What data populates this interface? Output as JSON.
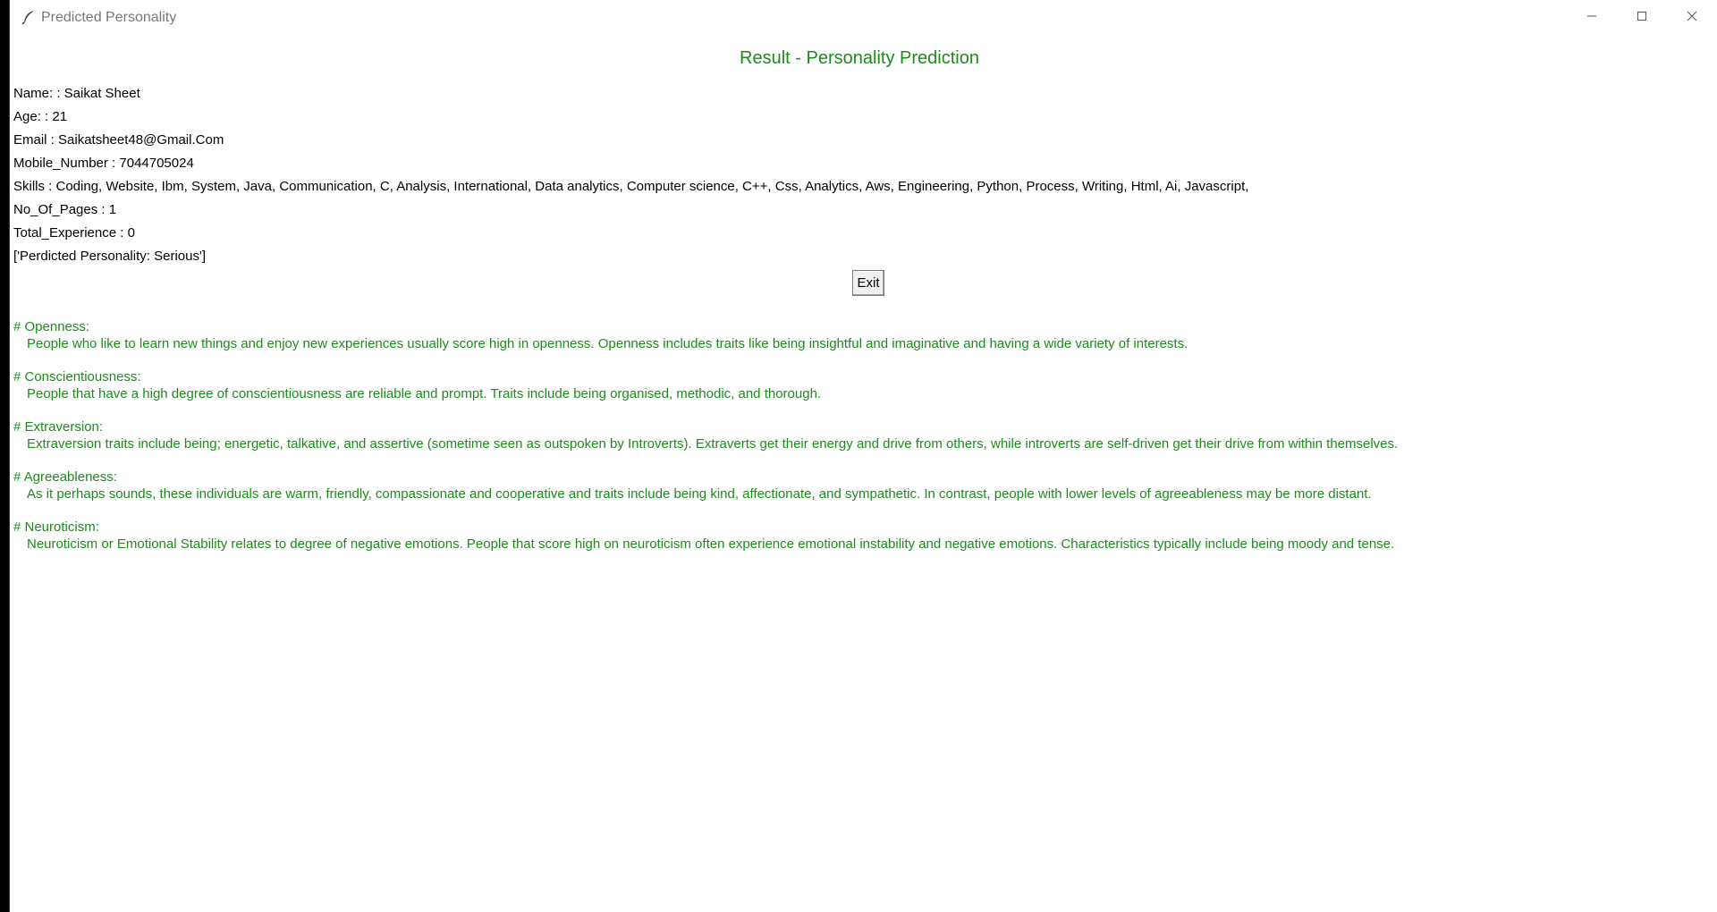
{
  "window": {
    "title": "Predicted Personality"
  },
  "heading": "Result - Personality Prediction",
  "info": {
    "name": "Name: : Saikat Sheet",
    "age": "Age: : 21",
    "email": "Email : Saikatsheet48@Gmail.Com",
    "mobile": "Mobile_Number : 7044705024",
    "skills": "Skills : Coding, Website, Ibm, System, Java, Communication, C, Analysis, International, Data analytics, Computer science, C++, Css, Analytics, Aws, Engineering, Python, Process, Writing, Html, Ai, Javascript,",
    "pages": "No_Of_Pages : 1",
    "experience": "Total_Experience : 0",
    "prediction": "['Perdicted Personality: Serious']"
  },
  "exit_label": "Exit",
  "traits": [
    {
      "title": "# Openness:",
      "description": "People who like to learn new things and enjoy new experiences usually score high in openness. Openness includes traits like being insightful and imaginative and having a wide variety of interests."
    },
    {
      "title": "# Conscientiousness:",
      "description": "People that have a high degree of conscientiousness are reliable and prompt. Traits include being organised, methodic, and thorough."
    },
    {
      "title": "# Extraversion:",
      "description": "Extraversion traits include being; energetic, talkative, and assertive (sometime seen as outspoken by Introverts). Extraverts get their energy and drive from others, while introverts are self-driven get their drive from within themselves."
    },
    {
      "title": "# Agreeableness:",
      "description": "As it perhaps sounds, these individuals are warm, friendly, compassionate and cooperative and traits include being kind, affectionate, and sympathetic. In contrast, people with lower levels of agreeableness may be more distant."
    },
    {
      "title": "# Neuroticism:",
      "description": "Neuroticism or Emotional Stability relates to degree of negative emotions. People that score high on neuroticism often experience emotional instability and negative emotions. Characteristics typically include being moody and tense."
    }
  ],
  "colors": {
    "accent_green": "#1e8a1e",
    "text": "#000000",
    "background": "#ffffff"
  },
  "icons": {
    "app": "feather-icon",
    "minimize": "minimize-icon",
    "maximize": "maximize-icon",
    "close": "close-icon"
  }
}
